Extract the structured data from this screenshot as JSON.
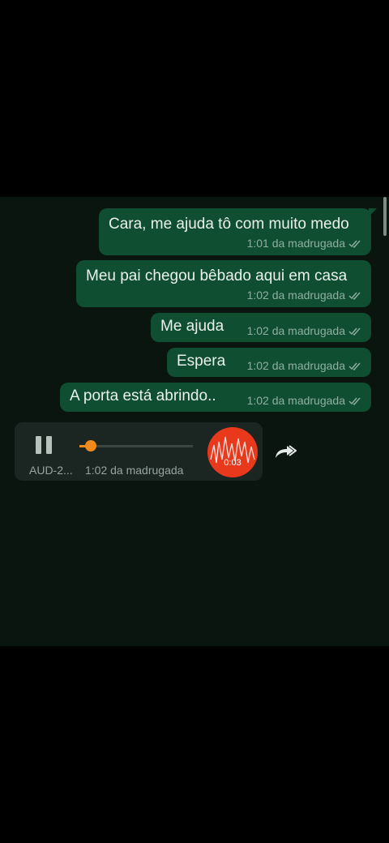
{
  "messages": [
    {
      "text": "Cara, me ajuda tô com muito medo",
      "time": "1:01 da madrugada",
      "status": "read-double-check-icon"
    },
    {
      "text": "Meu pai chegou bêbado aqui em casa",
      "time": "1:02 da madrugada",
      "status": "read-double-check-icon"
    },
    {
      "text": "Me ajuda",
      "time": "1:02 da madrugada",
      "status": "read-double-check-icon"
    },
    {
      "text": "Espera",
      "time": "1:02 da madrugada",
      "status": "read-double-check-icon"
    },
    {
      "text": "A porta está abrindo..",
      "time": "1:02 da madrugada",
      "status": "read-double-check-icon"
    }
  ],
  "audio": {
    "filename": "AUD-2...",
    "time": "1:02 da madrugada",
    "duration": "0:03",
    "progress": 0.1,
    "playing": true
  },
  "colors": {
    "chat_background": "#0b1510",
    "outgoing_bubble": "#0f4e31",
    "audio_accent": "#f08a1c",
    "avatar": "#e8391c"
  }
}
